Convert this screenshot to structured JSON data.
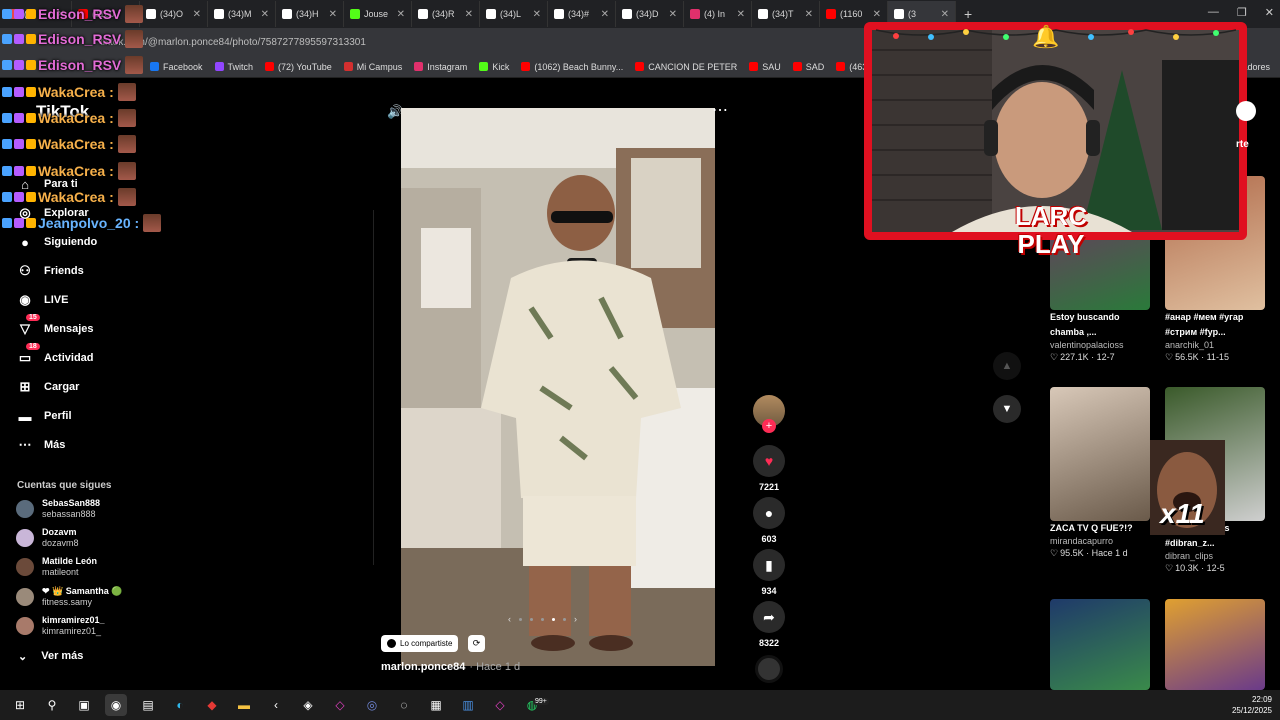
{
  "browser": {
    "tabs": [
      {
        "label": "(1",
        "color": "#e5484d"
      },
      {
        "label": "(1160",
        "color": "#ff0000"
      },
      {
        "label": "(34)O",
        "color": "#ffffff"
      },
      {
        "label": "(34)M",
        "color": "#ffffff"
      },
      {
        "label": "(34)H",
        "color": "#ffffff"
      },
      {
        "label": "Jouse",
        "color": "#53fc18"
      },
      {
        "label": "(34)R",
        "color": "#ffffff"
      },
      {
        "label": "(34)L",
        "color": "#ffffff"
      },
      {
        "label": "(34)#",
        "color": "#ffffff"
      },
      {
        "label": "(34)D",
        "color": "#ffffff"
      },
      {
        "label": "(4) In",
        "color": "#e1306c"
      },
      {
        "label": "(34)T",
        "color": "#ffffff"
      },
      {
        "label": "(1160",
        "color": "#ff0000"
      },
      {
        "label": "(3",
        "color": "#ffffff"
      }
    ],
    "url": "tiktok.com/@marlon.ponce84/photo/7587277895597313301",
    "bookmarks": [
      {
        "label": "Facebook",
        "color": "#1877f2"
      },
      {
        "label": "Twitch",
        "color": "#9146ff"
      },
      {
        "label": "(72) YouTube",
        "color": "#ff0000"
      },
      {
        "label": "Mi Campus",
        "color": "#d32f2f"
      },
      {
        "label": "Instagram",
        "color": "#e1306c"
      },
      {
        "label": "Kick",
        "color": "#53fc18"
      },
      {
        "label": "(1062) Beach Bunny...",
        "color": "#ff0000"
      },
      {
        "label": "CANCION DE PETER",
        "color": "#ff0000"
      },
      {
        "label": "SAU",
        "color": "#ff0000"
      },
      {
        "label": "SAD",
        "color": "#ff0000"
      },
      {
        "label": "(463) James Arthur -...",
        "color": "#ff0000"
      }
    ],
    "bookmarks_right": "cadores"
  },
  "chat": [
    {
      "user": "Edison_RSV",
      "color": "pink"
    },
    {
      "user": "Edison_RSV",
      "color": "pink"
    },
    {
      "user": "Edison_RSV",
      "color": "pink"
    },
    {
      "user": "WakaCrea :",
      "color": "orange"
    },
    {
      "user": "WakaCrea :",
      "color": "orange"
    },
    {
      "user": "WakaCrea :",
      "color": "orange"
    },
    {
      "user": "WakaCrea :",
      "color": "orange"
    },
    {
      "user": "WakaCrea :",
      "color": "orange"
    },
    {
      "user": "Jeanpolvo_20 :",
      "color": "blue"
    }
  ],
  "sidebar": {
    "logo": "TikTok",
    "nav": [
      {
        "label": "Para ti",
        "icon": "home-icon"
      },
      {
        "label": "Explorar",
        "icon": "compass-icon"
      },
      {
        "label": "Siguiendo",
        "icon": "following-icon"
      },
      {
        "label": "Friends",
        "icon": "friends-icon"
      },
      {
        "label": "LIVE",
        "icon": "live-icon"
      },
      {
        "label": "Mensajes",
        "icon": "messages-icon",
        "badge": "15"
      },
      {
        "label": "Actividad",
        "icon": "activity-icon",
        "badge": "18"
      },
      {
        "label": "Cargar",
        "icon": "upload-icon"
      },
      {
        "label": "Perfil",
        "icon": "profile-icon"
      },
      {
        "label": "Más",
        "icon": "more-icon"
      }
    ],
    "following_title": "Cuentas que sigues",
    "following": [
      {
        "name": "SebasSan888",
        "handle": "sebassan888"
      },
      {
        "name": "Dozavm",
        "handle": "dozavm8"
      },
      {
        "name": "Matilde León",
        "handle": "matileont"
      },
      {
        "name": "❤ 👑 Samantha 🟢",
        "handle": "fitness.samy"
      },
      {
        "name": "kimramirez01_",
        "handle": "kimramirez01_"
      }
    ],
    "see_more": "Ver más"
  },
  "post": {
    "share_label": "Lo compartiste",
    "author": "marlon.ponce84",
    "time": "· Hace 1 d",
    "likes": "7221",
    "comments": "603",
    "saves": "934",
    "shares": "8322"
  },
  "recommendations": [
    {
      "title": "Estoy buscando chamba ,...",
      "author": "valentinopalacioss",
      "stats": "227.1K · 12-7"
    },
    {
      "title": "#анар #мем #угар #стрим #fyp...",
      "author": "anarchik_01",
      "stats": "56.5K · 11-15"
    },
    {
      "title": "ZACA TV Q FUE?!?",
      "author": "mirandacapurro",
      "stats": "95.5K · Hace 1 d"
    },
    {
      "title": "#jhonycevallos #dibran_z...",
      "author": "dibran_clips",
      "stats": "10.3K · 12-5"
    }
  ],
  "overlay": {
    "logo_line1": "LARC",
    "logo_line2": "PLAY",
    "emote_count": "x11",
    "side_tab": "rte"
  },
  "taskbar": {
    "time": "22:09",
    "date": "25/12/2025",
    "badge": "99+"
  }
}
